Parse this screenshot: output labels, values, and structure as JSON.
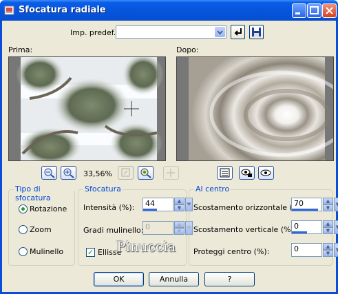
{
  "window": {
    "title": "Sfocatura radiale"
  },
  "preset": {
    "label": "Imp. predef.:",
    "value": ""
  },
  "previews": {
    "before_label": "Prima:",
    "after_label": "Dopo:"
  },
  "zoom": {
    "level": "33,56%"
  },
  "blur_type": {
    "legend": "Tipo di sfocatura",
    "options": [
      "Rotazione",
      "Zoom",
      "Mulinello"
    ],
    "selected": "Rotazione"
  },
  "blur": {
    "legend": "Sfocatura",
    "intensity_label": "Intensità (%):",
    "intensity_value": "44",
    "intensity_fraction": 0.44,
    "twirl_label": "Gradi mulinello:",
    "twirl_value": "0",
    "ellipse_label": "Ellisse",
    "ellipse_checked": true
  },
  "center": {
    "legend": "Al centro",
    "h_offset_label": "Scostamento orizzontale (%):",
    "h_offset_value": "70",
    "h_offset_fraction": 0.85,
    "v_offset_label": "Scostamento verticale (%):",
    "v_offset_value": "0",
    "v_offset_fraction": 0.5,
    "protect_label": "Proteggi centro (%):",
    "protect_value": "0"
  },
  "watermark": "Pinuccia",
  "buttons": {
    "ok": "OK",
    "cancel": "Annulla",
    "help": "?"
  }
}
